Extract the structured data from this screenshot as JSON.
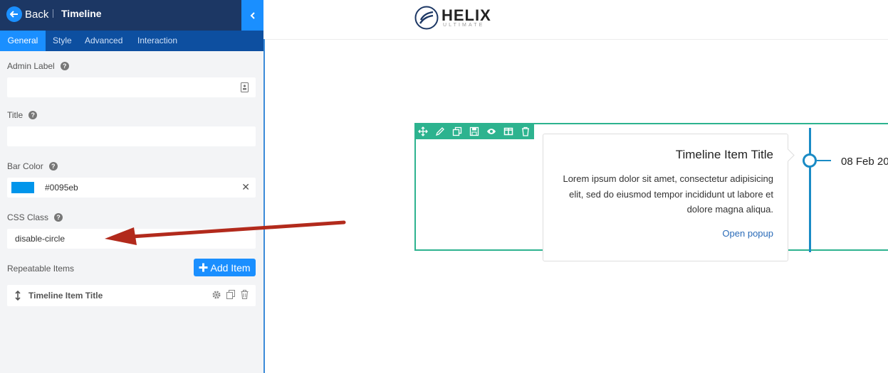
{
  "topbar": {
    "back_label": "Back",
    "title": "Timeline"
  },
  "tabs": [
    {
      "label": "General",
      "active": true
    },
    {
      "label": "Style",
      "active": false
    },
    {
      "label": "Advanced",
      "active": false
    },
    {
      "label": "Interaction",
      "active": false
    }
  ],
  "fields": {
    "admin_label": {
      "label": "Admin Label",
      "value": ""
    },
    "title": {
      "label": "Title",
      "value": ""
    },
    "bar_color": {
      "label": "Bar Color",
      "value": "#0095eb",
      "swatch": "#0095eb"
    },
    "css_class": {
      "label": "CSS Class",
      "value": "disable-circle"
    }
  },
  "repeatable": {
    "label": "Repeatable Items",
    "add_button": "Add Item",
    "items": [
      {
        "title": "Timeline Item Title"
      }
    ]
  },
  "preview": {
    "logo_word": "HELIX",
    "logo_sub": "ULTIMATE",
    "timeline": {
      "item_title": "Timeline Item Title",
      "body": "Lorem ipsum dolor sit amet, consectetur adipisicing elit, sed do eiusmod tempor incididunt ut labore et dolore magna aliqua.",
      "link": "Open popup",
      "date": "08 Feb 20"
    }
  },
  "colors": {
    "topbar": "#1c3764",
    "accent": "#1a8fff",
    "tabs": "#0d4fa0",
    "addon_border": "#2db38f",
    "timeline_line": "#1a8bc5",
    "annotation_arrow": "#b22a1c"
  }
}
